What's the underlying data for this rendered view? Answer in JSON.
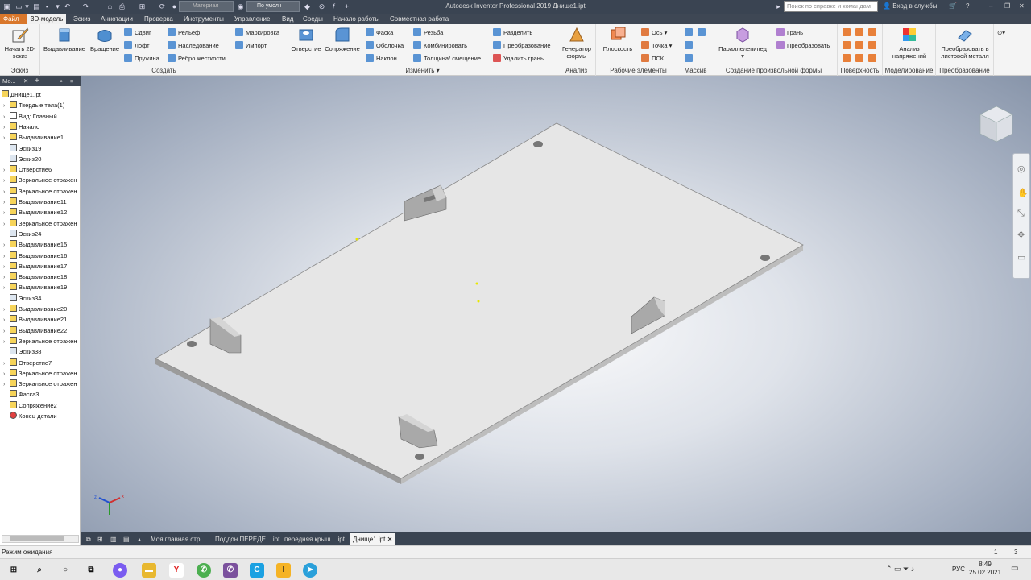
{
  "window": {
    "title": "Autodesk Inventor Professional 2019   Днище1.ipt",
    "material_combo": "Материал",
    "appearance_combo": "По умолч",
    "search_placeholder": "Поиск по справке и командам",
    "signin": "Вход в службы"
  },
  "tabs": [
    "Файл",
    "3D-модель",
    "Эскиз",
    "Аннотации",
    "Проверка",
    "Инструменты",
    "Управление",
    "Вид",
    "Среды",
    "Начало работы",
    "Совместная работа"
  ],
  "active_tab": "3D-модель",
  "ribbon": {
    "sketch_panel": {
      "title": "Эскиз",
      "start_sketch": "Начать 2D-эскиз"
    },
    "create_panel": {
      "title": "Создать",
      "extrude": "Выдавливание",
      "revolve": "Вращение",
      "sweep": "Сдвиг",
      "loft": "Лофт",
      "coil": "Пружина",
      "emboss": "Рельеф",
      "derive": "Наследование",
      "rib": "Ребро жесткости",
      "decal": "Маркировка",
      "import": "Импорт"
    },
    "modify_panel": {
      "title": "Изменить",
      "hole": "Отверстие",
      "fillet": "Сопряжение",
      "chamfer": "Фаска",
      "shell": "Оболочка",
      "draft": "Наклон",
      "thread": "Резьба",
      "combine": "Комбинировать",
      "thicken": "Толщина/ смещение",
      "split": "Разделить",
      "direct": "Преобразование",
      "delete_face": "Удалить грань"
    },
    "analysis_panel": {
      "title": "Анализ",
      "shape_gen": "Генератор формы"
    },
    "work_panel": {
      "title": "Рабочие элементы",
      "plane": "Плоскость",
      "axis": "Ось",
      "point": "Точка",
      "ucs": "ПСК"
    },
    "pattern_panel": {
      "title": "Массив"
    },
    "freeform_panel": {
      "title": "Создание произвольной формы",
      "box": "Параллелепипед",
      "face": "Грань",
      "convert": "Преобразовать"
    },
    "surface_panel": {
      "title": "Поверхность"
    },
    "simulation_panel": {
      "title": "Моделирование",
      "stress": "Анализ напряжений"
    },
    "convert_panel": {
      "title": "Преобразование",
      "to_sheet": "Преобразовать в листовой металл"
    }
  },
  "browser": {
    "tab_label": "Мо...",
    "items": [
      {
        "label": "Днище1.ipt",
        "icon": "part-icon",
        "expand": ""
      },
      {
        "label": "Твердые тела(1)",
        "icon": "solid-bodies-icon",
        "expand": "›"
      },
      {
        "label": "Вид: Главный",
        "icon": "view-icon",
        "expand": "›"
      },
      {
        "label": "Начало",
        "icon": "origin-folder-icon",
        "expand": "›"
      },
      {
        "label": "Выдавливание1",
        "icon": "extrude-icon",
        "expand": "›"
      },
      {
        "label": "Эскиз19",
        "icon": "sketch-icon",
        "expand": ""
      },
      {
        "label": "Эскиз20",
        "icon": "sketch-icon",
        "expand": ""
      },
      {
        "label": "Отверстие6",
        "icon": "hole-icon",
        "expand": "›"
      },
      {
        "label": "Зеркальное отражен",
        "icon": "mirror-icon",
        "expand": "›"
      },
      {
        "label": "Зеркальное отражен",
        "icon": "mirror-icon",
        "expand": "›"
      },
      {
        "label": "Выдавливание11",
        "icon": "extrude-icon",
        "expand": "›"
      },
      {
        "label": "Выдавливание12",
        "icon": "extrude-icon",
        "expand": "›"
      },
      {
        "label": "Зеркальное отражен",
        "icon": "mirror-icon",
        "expand": "›"
      },
      {
        "label": "Эскиз24",
        "icon": "sketch-icon",
        "expand": ""
      },
      {
        "label": "Выдавливание15",
        "icon": "extrude-icon",
        "expand": "›"
      },
      {
        "label": "Выдавливание16",
        "icon": "extrude-icon",
        "expand": "›"
      },
      {
        "label": "Выдавливание17",
        "icon": "extrude-icon",
        "expand": "›"
      },
      {
        "label": "Выдавливание18",
        "icon": "extrude-icon",
        "expand": "›"
      },
      {
        "label": "Выдавливание19",
        "icon": "extrude-icon",
        "expand": "›"
      },
      {
        "label": "Эскиз34",
        "icon": "sketch-icon",
        "expand": ""
      },
      {
        "label": "Выдавливание20",
        "icon": "extrude-icon",
        "expand": "›"
      },
      {
        "label": "Выдавливание21",
        "icon": "extrude-icon",
        "expand": "›"
      },
      {
        "label": "Выдавливание22",
        "icon": "extrude-icon",
        "expand": "›"
      },
      {
        "label": "Зеркальное отражен",
        "icon": "mirror-icon",
        "expand": "›"
      },
      {
        "label": "Эскиз38",
        "icon": "sketch-icon",
        "expand": ""
      },
      {
        "label": "Отверстие7",
        "icon": "hole-icon",
        "expand": "›"
      },
      {
        "label": "Зеркальное отражен",
        "icon": "mirror-icon",
        "expand": "›"
      },
      {
        "label": "Зеркальное отражен",
        "icon": "mirror-icon",
        "expand": "›"
      },
      {
        "label": "Фаска3",
        "icon": "chamfer-icon",
        "expand": ""
      },
      {
        "label": "Сопряжение2",
        "icon": "fillet-icon",
        "expand": ""
      },
      {
        "label": "Конец детали",
        "icon": "end-of-part-icon",
        "expand": ""
      }
    ]
  },
  "doc_tabs": [
    "Моя главная стр...",
    "Поддон ПЕРЕДЕ....ipt",
    "передняя крыш....ipt",
    "Днище1.ipt"
  ],
  "active_doc": "Днище1.ipt",
  "status": {
    "text": "Режим ожидания",
    "count1": "1",
    "count2": "3"
  },
  "taskbar": {
    "time": "8:49",
    "date": "25.02.2021",
    "lang": "РУС"
  },
  "colors": {
    "file_tab": "#d9772b",
    "title_bar": "#3a4452",
    "part_face": "#e6e6e6"
  }
}
